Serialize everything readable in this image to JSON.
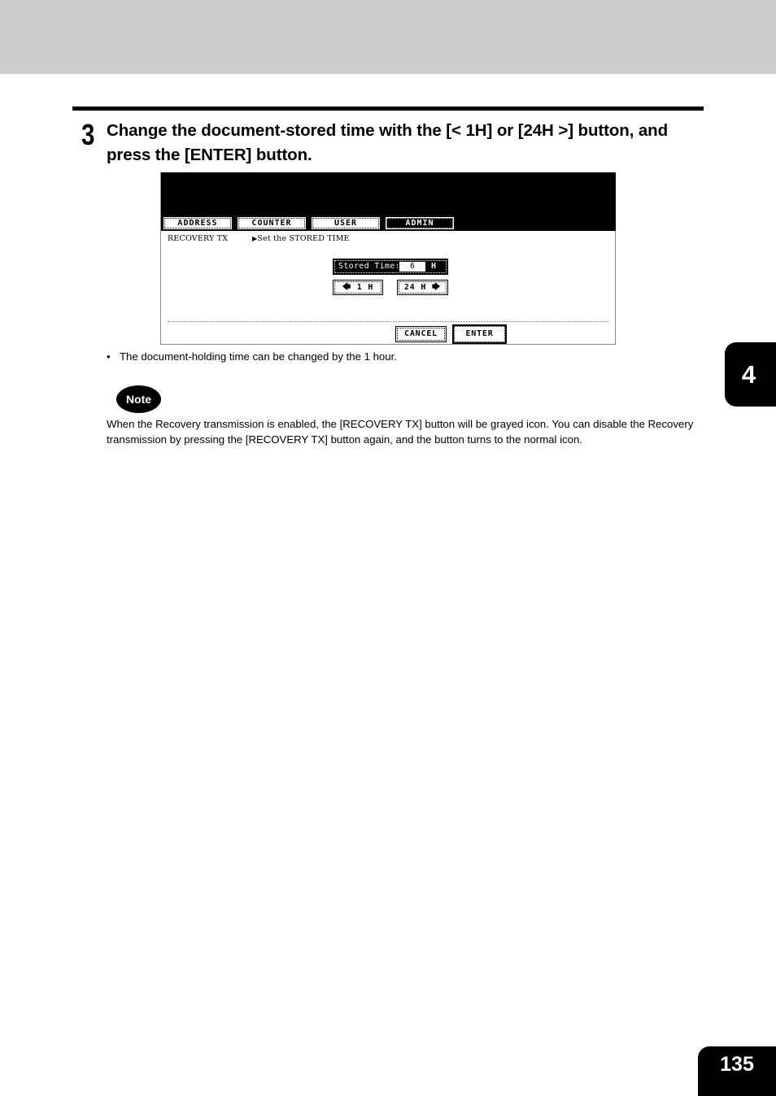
{
  "step": {
    "number": "3",
    "title": "Change the document-stored time with the [< 1H] or [24H >] button, and press the [ENTER] button."
  },
  "panel": {
    "tabs": [
      {
        "label": "ADDRESS",
        "active": false
      },
      {
        "label": "COUNTER",
        "active": false
      },
      {
        "label": "USER",
        "active": false
      },
      {
        "label": "ADMIN",
        "active": true
      }
    ],
    "breadcrumb_left": "RECOVERY TX",
    "breadcrumb_right": "Set the STORED TIME",
    "breadcrumb_icon": "right-triangle-icon",
    "stored_time": {
      "label": "Stored Time:",
      "value": "6",
      "unit": "H"
    },
    "decrement_button": {
      "icon": "left-arrow-icon",
      "label": "1 H"
    },
    "increment_button": {
      "label": "24 H",
      "icon": "right-arrow-icon"
    },
    "cancel_label": "CANCEL",
    "enter_label": "ENTER"
  },
  "bullet": {
    "marker": "•",
    "text": "The document-holding time can be changed by the 1 hour."
  },
  "note": {
    "badge": "Note",
    "text": "When the Recovery transmission is enabled, the [RECOVERY TX] button will be grayed icon.  You can disable the Recovery transmission by pressing the [RECOVERY TX] button again, and the button turns to the normal icon."
  },
  "chapter_tab": "4",
  "page_number": "135"
}
